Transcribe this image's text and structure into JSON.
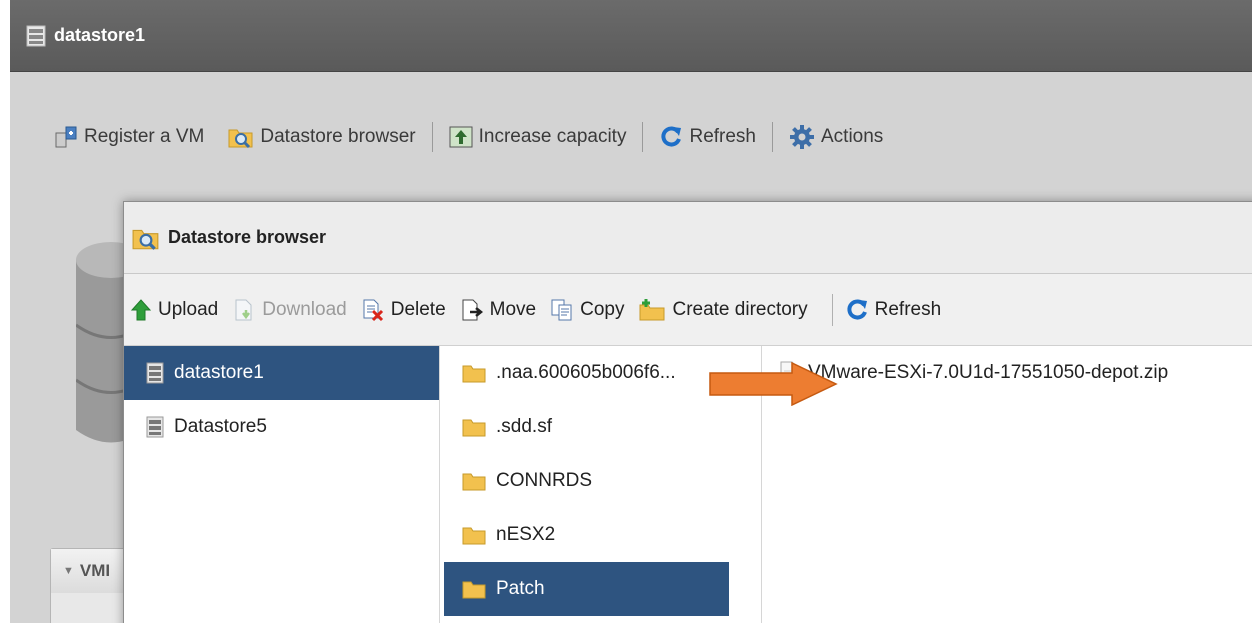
{
  "outer": {
    "title": "datastore1",
    "toolbar": {
      "register_vm": "Register a VM",
      "datastore_browser": "Datastore browser",
      "increase_capacity": "Increase capacity",
      "refresh": "Refresh",
      "actions": "Actions"
    },
    "vm_panel_label": "VMI"
  },
  "dialog": {
    "title": "Datastore browser",
    "toolbar": {
      "upload": "Upload",
      "download": "Download",
      "delete": "Delete",
      "move": "Move",
      "copy": "Copy",
      "create_directory": "Create directory",
      "refresh": "Refresh"
    },
    "datastores": [
      {
        "label": "datastore1",
        "selected": true
      },
      {
        "label": "Datastore5",
        "selected": false
      }
    ],
    "folders": [
      {
        "label": ".naa.600605b006f6...",
        "selected": false
      },
      {
        "label": ".sdd.sf",
        "selected": false
      },
      {
        "label": "CONNRDS",
        "selected": false
      },
      {
        "label": "nESX2",
        "selected": false
      },
      {
        "label": "Patch",
        "selected": true
      }
    ],
    "files": [
      {
        "label": "VMware-ESXi-7.0U1d-17551050-depot.zip"
      }
    ]
  },
  "colors": {
    "selection": "#2e5480",
    "arrow": "#ed7d31"
  }
}
